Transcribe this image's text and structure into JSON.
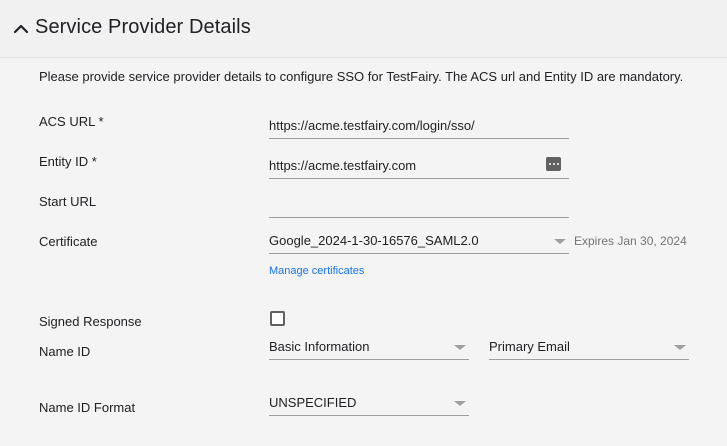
{
  "section": {
    "title": "Service Provider Details",
    "intro": "Please provide service provider details to configure SSO for TestFairy. The ACS url and Entity ID are mandatory."
  },
  "fields": {
    "acs_url": {
      "label": "ACS URL *",
      "value": "https://acme.testfairy.com/login/sso/"
    },
    "entity_id": {
      "label": "Entity ID *",
      "value": "https://acme.testfairy.com"
    },
    "start_url": {
      "label": "Start URL",
      "value": ""
    },
    "certificate": {
      "label": "Certificate",
      "value": "Google_2024-1-30-16576_SAML2.0",
      "expires": "Expires Jan 30, 2024",
      "manage_link": "Manage certificates"
    },
    "signed_response": {
      "label": "Signed Response",
      "checked": false
    },
    "name_id": {
      "label": "Name ID",
      "value1": "Basic Information",
      "value2": "Primary Email"
    },
    "name_id_format": {
      "label": "Name ID Format",
      "value": "UNSPECIFIED"
    }
  },
  "icons": {
    "collapse": "chevron-up-icon",
    "entity_menu": "more-horiz-icon",
    "dropdown": "arrow-drop-down-icon"
  },
  "colors": {
    "link": "#1a73e8",
    "underline": "#9e9e9e",
    "background": "#f4f4f4"
  }
}
